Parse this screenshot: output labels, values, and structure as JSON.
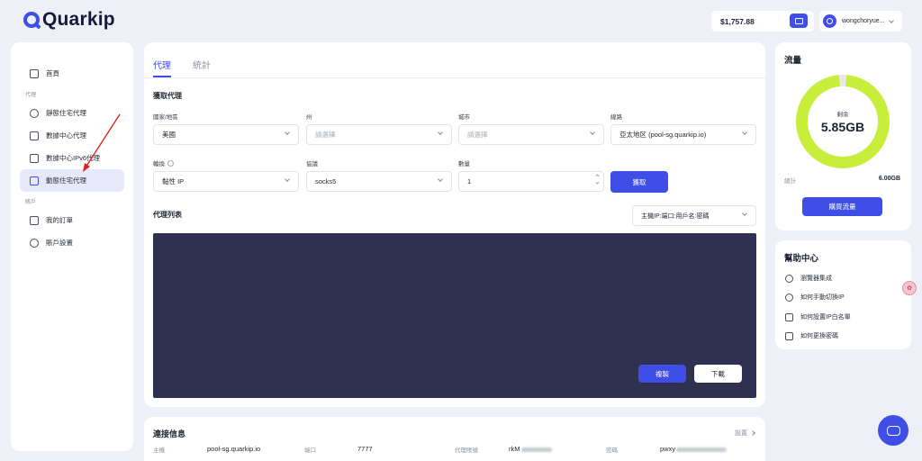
{
  "brand": {
    "name": "Quarkip",
    "accent": "#3f4ee6"
  },
  "header": {
    "balance": "$1,757.88",
    "username": "wongchoryue..."
  },
  "sidebar": {
    "home": "首頁",
    "group_proxy": "代理",
    "items": [
      {
        "label": "靜態住宅代理",
        "icon": "location-pin-icon"
      },
      {
        "label": "數據中心代理",
        "icon": "server-icon"
      },
      {
        "label": "數據中心IPv6代理",
        "icon": "server-v6-icon"
      },
      {
        "label": "動態住宅代理",
        "icon": "monitor-icon",
        "active": true
      }
    ],
    "group_account": "賬戶",
    "account_items": [
      {
        "label": "我的訂單",
        "icon": "order-icon"
      },
      {
        "label": "賬戶設置",
        "icon": "gear-icon"
      }
    ]
  },
  "main": {
    "tabs": [
      {
        "label": "代理",
        "active": true
      },
      {
        "label": "統計",
        "active": false
      }
    ],
    "fetch_title": "獲取代理",
    "fields": {
      "country_label": "國家/地區",
      "country_value": "美國",
      "state_label": "州",
      "state_placeholder": "請選擇",
      "city_label": "城市",
      "city_placeholder": "請選擇",
      "line_label": "線路",
      "line_value": "亞太地区 (pool-sg.quarkip.io)",
      "rotation_label": "輪換",
      "rotation_value": "黏性 IP",
      "protocol_label": "協議",
      "protocol_value": "socks5",
      "quantity_label": "數量",
      "quantity_value": "1"
    },
    "fetch_button": "獲取",
    "list_title": "代理列表",
    "format_value": "主機IP:端口:用戶名:密碼",
    "copy_button": "複製",
    "download_button": "下載"
  },
  "connection": {
    "title": "連接信息",
    "settings": "設置",
    "host_label": "主機",
    "host_value": "pool-sg.quarkip.io",
    "port_label": "端口",
    "port_value": "7777",
    "account_label": "代理賬號",
    "account_value": "rkM",
    "password_label": "密碼",
    "password_value": "pwxy"
  },
  "traffic": {
    "title": "流量",
    "remaining_label": "剩余",
    "remaining_value": "5.85GB",
    "remaining_fraction": 0.975,
    "ring_color": "#c6ee3a",
    "total_label": "總計",
    "total_value": "6.00GB",
    "buy_button": "購買流量"
  },
  "help": {
    "title": "幫助中心",
    "items": [
      {
        "label": "瀏覽器集成",
        "icon": "globe-icon"
      },
      {
        "label": "如何手動切換IP",
        "icon": "link-icon"
      },
      {
        "label": "如何設置IP白名單",
        "icon": "card-icon"
      },
      {
        "label": "如何更換密碼",
        "icon": "lock-icon"
      }
    ]
  }
}
